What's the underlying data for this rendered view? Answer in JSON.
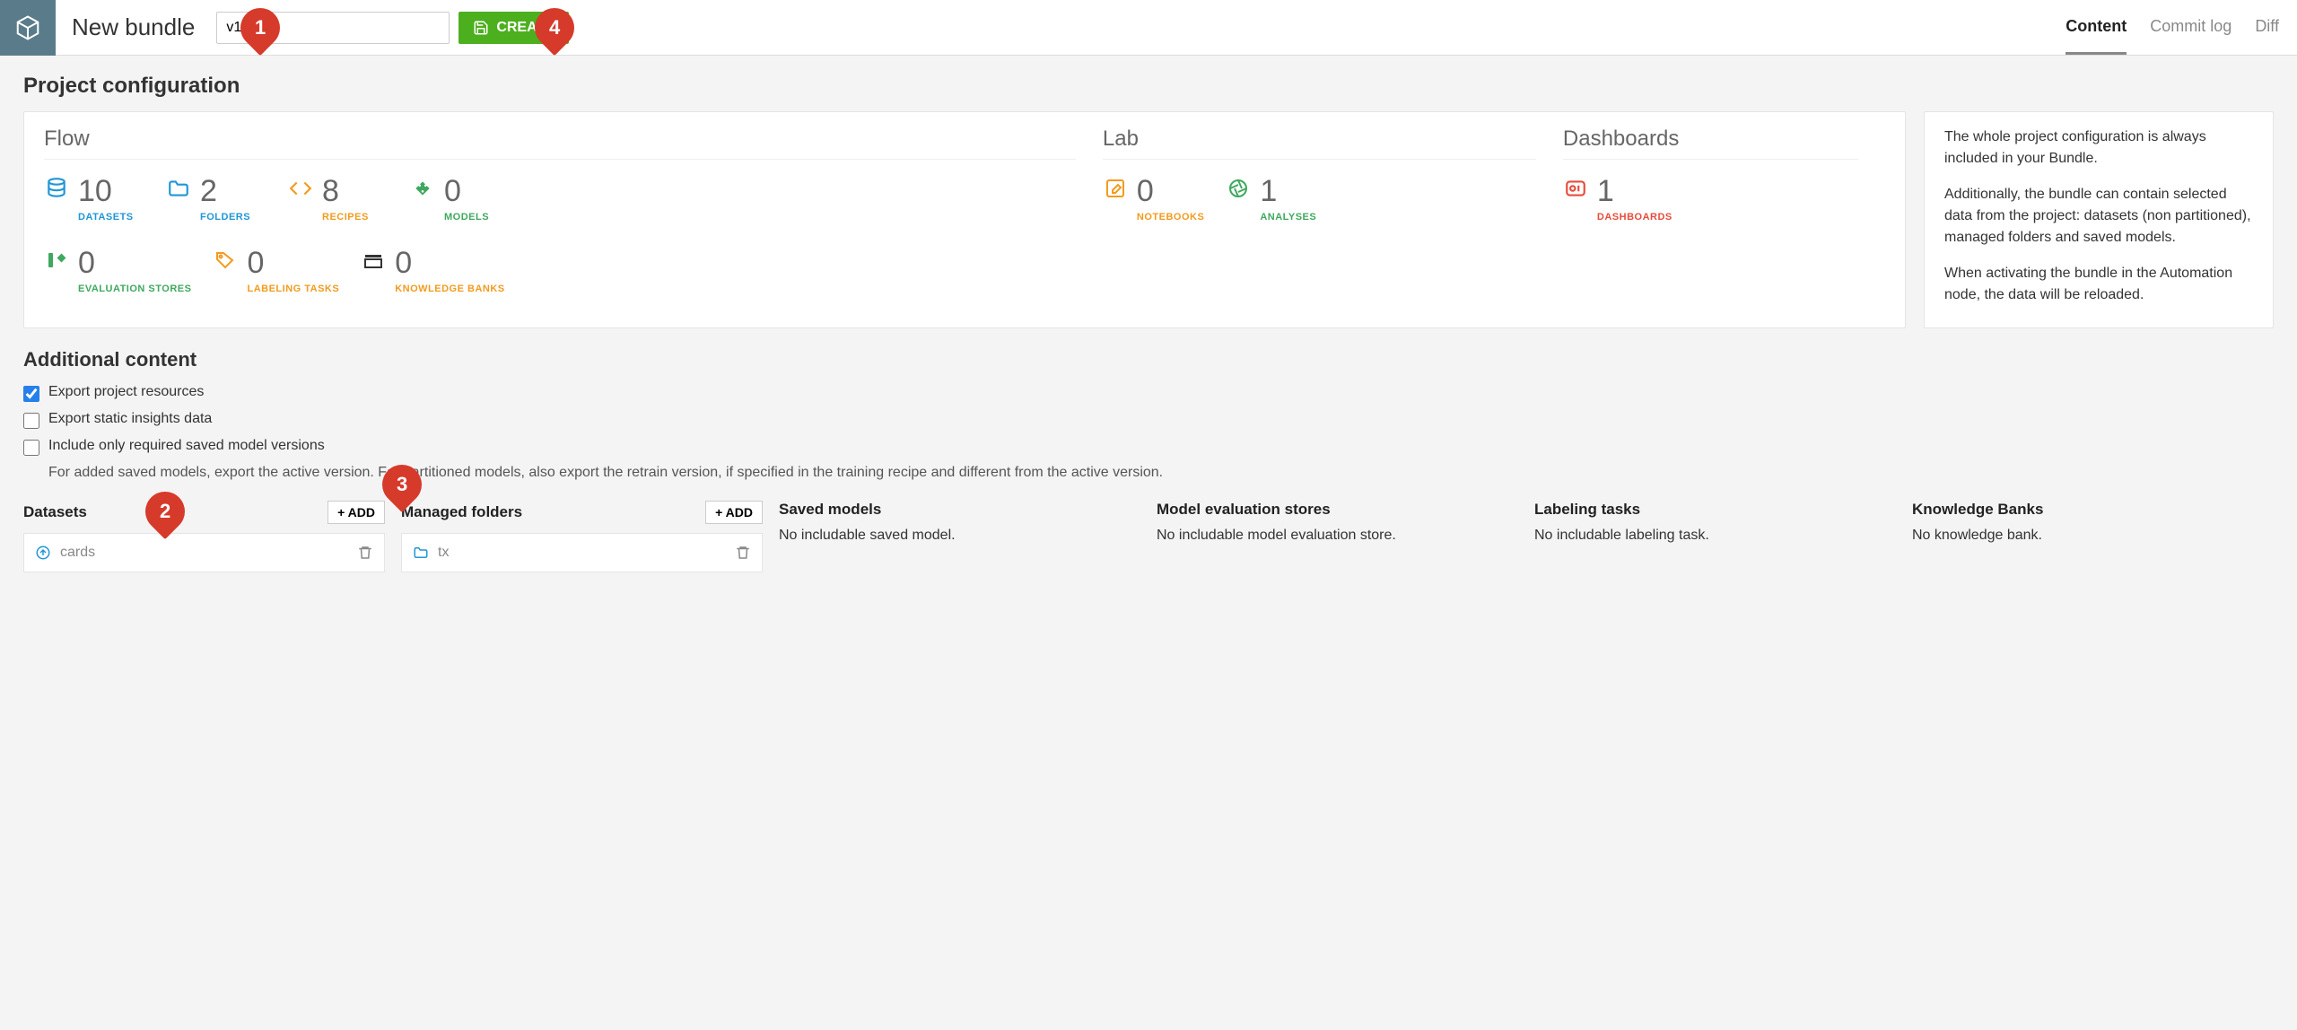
{
  "header": {
    "title": "New bundle",
    "name_value": "v1",
    "create_label": "CREATE",
    "tabs": [
      {
        "label": "Content",
        "active": true
      },
      {
        "label": "Commit log",
        "active": false
      },
      {
        "label": "Diff",
        "active": false
      }
    ]
  },
  "project_config": {
    "title": "Project configuration",
    "groups": {
      "flow": {
        "title": "Flow",
        "stats": [
          {
            "icon": "database",
            "count": "10",
            "label": "DATASETS",
            "color": "blue"
          },
          {
            "icon": "folder",
            "count": "2",
            "label": "FOLDERS",
            "color": "blue"
          },
          {
            "icon": "code",
            "count": "8",
            "label": "RECIPES",
            "color": "orange"
          },
          {
            "icon": "diamond",
            "count": "0",
            "label": "MODELS",
            "color": "green"
          },
          {
            "icon": "eval",
            "count": "0",
            "label": "EVALUATION STORES",
            "color": "green"
          },
          {
            "icon": "tag",
            "count": "0",
            "label": "LABELING TASKS",
            "color": "orange"
          },
          {
            "icon": "bank",
            "count": "0",
            "label": "KNOWLEDGE BANKS",
            "color": "dark"
          }
        ]
      },
      "lab": {
        "title": "Lab",
        "stats": [
          {
            "icon": "edit",
            "count": "0",
            "label": "NOTEBOOKS",
            "color": "orange"
          },
          {
            "icon": "aperture",
            "count": "1",
            "label": "ANALYSES",
            "color": "green"
          }
        ]
      },
      "dashboards": {
        "title": "Dashboards",
        "stats": [
          {
            "icon": "dashboard",
            "count": "1",
            "label": "DASHBOARDS",
            "color": "red"
          }
        ]
      }
    },
    "info": {
      "p1": "The whole project configuration is always included in your Bundle.",
      "p2": "Additionally, the bundle can contain selected data from the project: datasets (non partitioned), managed folders and saved models.",
      "p3": "When activating the bundle in the Automation node, the data will be reloaded."
    }
  },
  "additional": {
    "title": "Additional content",
    "checkboxes": {
      "export_resources": {
        "label": "Export project resources",
        "checked": true
      },
      "export_insights": {
        "label": "Export static insights data",
        "checked": false
      },
      "include_models": {
        "label": "Include only required saved model versions",
        "checked": false
      }
    },
    "hint": "For added saved models, export the active version. For partitioned models, also export the retrain version, if specified in the training recipe and different from the active version.",
    "columns": {
      "datasets": {
        "title": "Datasets",
        "add": "+ ADD",
        "item": "cards"
      },
      "folders": {
        "title": "Managed folders",
        "add": "+ ADD",
        "item": "tx"
      },
      "models": {
        "title": "Saved models",
        "empty": "No includable saved model."
      },
      "eval": {
        "title": "Model evaluation stores",
        "empty": "No includable model evaluation store."
      },
      "labeling": {
        "title": "Labeling tasks",
        "empty": "No includable labeling task."
      },
      "knowledge": {
        "title": "Knowledge Banks",
        "empty": "No knowledge bank."
      }
    }
  },
  "callouts": {
    "c1": "1",
    "c2": "2",
    "c3": "3",
    "c4": "4"
  }
}
